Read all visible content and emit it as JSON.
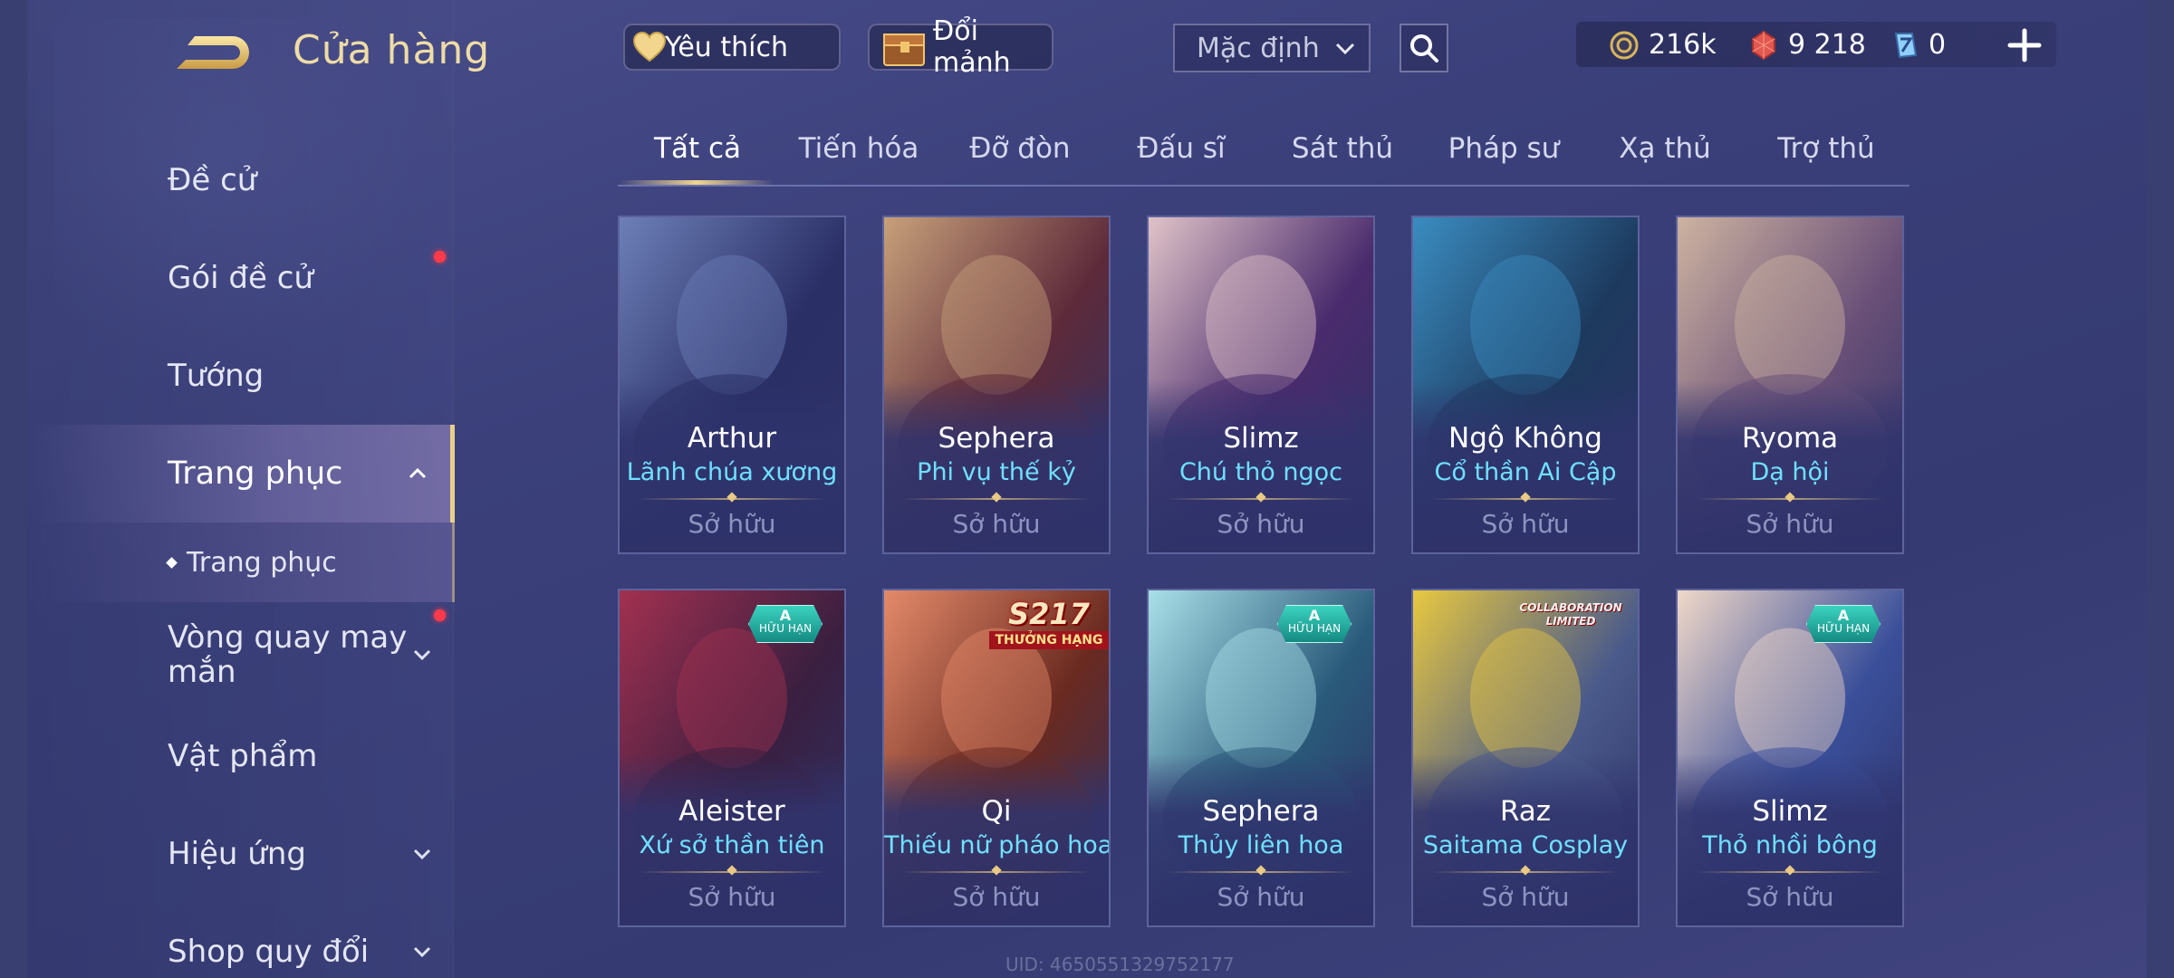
{
  "header": {
    "title": "Cửa hàng",
    "back_icon": "back-arrow-icon",
    "favorites_label": "Yêu thích",
    "exchange_label": "Đổi mảnh",
    "sort_select": {
      "value": "Mặc định"
    },
    "search_icon": "search-icon"
  },
  "currencies": [
    {
      "name": "gold",
      "icon": "coin-icon",
      "value": "216k",
      "color": "#d7b45c"
    },
    {
      "name": "voucher",
      "icon": "red-gem-icon",
      "value": "9 218",
      "color": "#e0584f"
    },
    {
      "name": "token",
      "icon": "blue-crystal-icon",
      "value": "0",
      "color": "#8fd0ff"
    }
  ],
  "sidebar": {
    "items": [
      {
        "label": "Đề cử"
      },
      {
        "label": "Gói đề cử",
        "notification": true
      },
      {
        "label": "Tướng"
      },
      {
        "label": "Trang phục",
        "expanded": true,
        "active": true
      },
      {
        "label": "Trang phục",
        "sub": true,
        "active": true
      },
      {
        "label": "Vòng quay may mắn",
        "notification": true,
        "expandable": true
      },
      {
        "label": "Vật phẩm"
      },
      {
        "label": "Hiệu ứng",
        "expandable": true
      },
      {
        "label": "Shop quy đổi",
        "expandable": true
      }
    ]
  },
  "tabs": [
    {
      "label": "Tất cả",
      "active": true
    },
    {
      "label": "Tiến hóa"
    },
    {
      "label": "Đỡ đòn"
    },
    {
      "label": "Đấu sĩ"
    },
    {
      "label": "Sát thủ"
    },
    {
      "label": "Pháp sư"
    },
    {
      "label": "Xạ thủ"
    },
    {
      "label": "Trợ thủ"
    }
  ],
  "skins": [
    {
      "hero": "Arthur",
      "skin": "Lãnh chúa xương",
      "status": "Sở hữu",
      "palette": [
        "#2a2f66",
        "#6d7fb8"
      ]
    },
    {
      "hero": "Sephera",
      "skin": "Phi vụ thế kỷ",
      "status": "Sở hữu",
      "palette": [
        "#5d2a3a",
        "#c8a07a"
      ]
    },
    {
      "hero": "Slimz",
      "skin": "Chú thỏ ngọc",
      "status": "Sở hữu",
      "palette": [
        "#4a2b6d",
        "#e0c3c8"
      ]
    },
    {
      "hero": "Ngộ Không",
      "skin": "Cổ thần Ai Cập",
      "status": "Sở hữu",
      "palette": [
        "#1d3a5e",
        "#3a8cc0"
      ]
    },
    {
      "hero": "Ryoma",
      "skin": "Dạ hội",
      "status": "Sở hữu",
      "palette": [
        "#6a5078",
        "#cdb3a0"
      ]
    },
    {
      "hero": "Aleister",
      "skin": "Xứ sở thần tiên",
      "status": "Sở hữu",
      "palette": [
        "#3a1f40",
        "#a23050"
      ],
      "badge": {
        "type": "a",
        "rank": "A",
        "text": "HỮU HẠN"
      }
    },
    {
      "hero": "Qi",
      "skin": "Thiếu nữ pháo hoa",
      "status": "Sở hữu",
      "palette": [
        "#6a2a20",
        "#e48a6a"
      ],
      "badge": {
        "type": "s",
        "rank": "S217",
        "text": "THƯỞNG HẠNG"
      }
    },
    {
      "hero": "Sephera",
      "skin": "Thủy liên hoa",
      "status": "Sở hữu",
      "palette": [
        "#2a5a7a",
        "#a8e0e8"
      ],
      "badge": {
        "type": "a",
        "rank": "A",
        "text": "HỮU HẠN"
      }
    },
    {
      "hero": "Raz",
      "skin": "Saitama Cosplay",
      "status": "Sở hữu",
      "palette": [
        "#4a5a8a",
        "#e8c840"
      ],
      "badge": {
        "type": "collab",
        "rank": "COLLABORATION",
        "text": "LIMITED"
      }
    },
    {
      "hero": "Slimz",
      "skin": "Thỏ nhồi bông",
      "status": "Sở hữu",
      "palette": [
        "#3a4f9a",
        "#f0d8c8"
      ],
      "badge": {
        "type": "a",
        "rank": "A",
        "text": "HỮU HẠN"
      }
    }
  ],
  "footer": {
    "uid": "UID: 4650551329752177"
  }
}
